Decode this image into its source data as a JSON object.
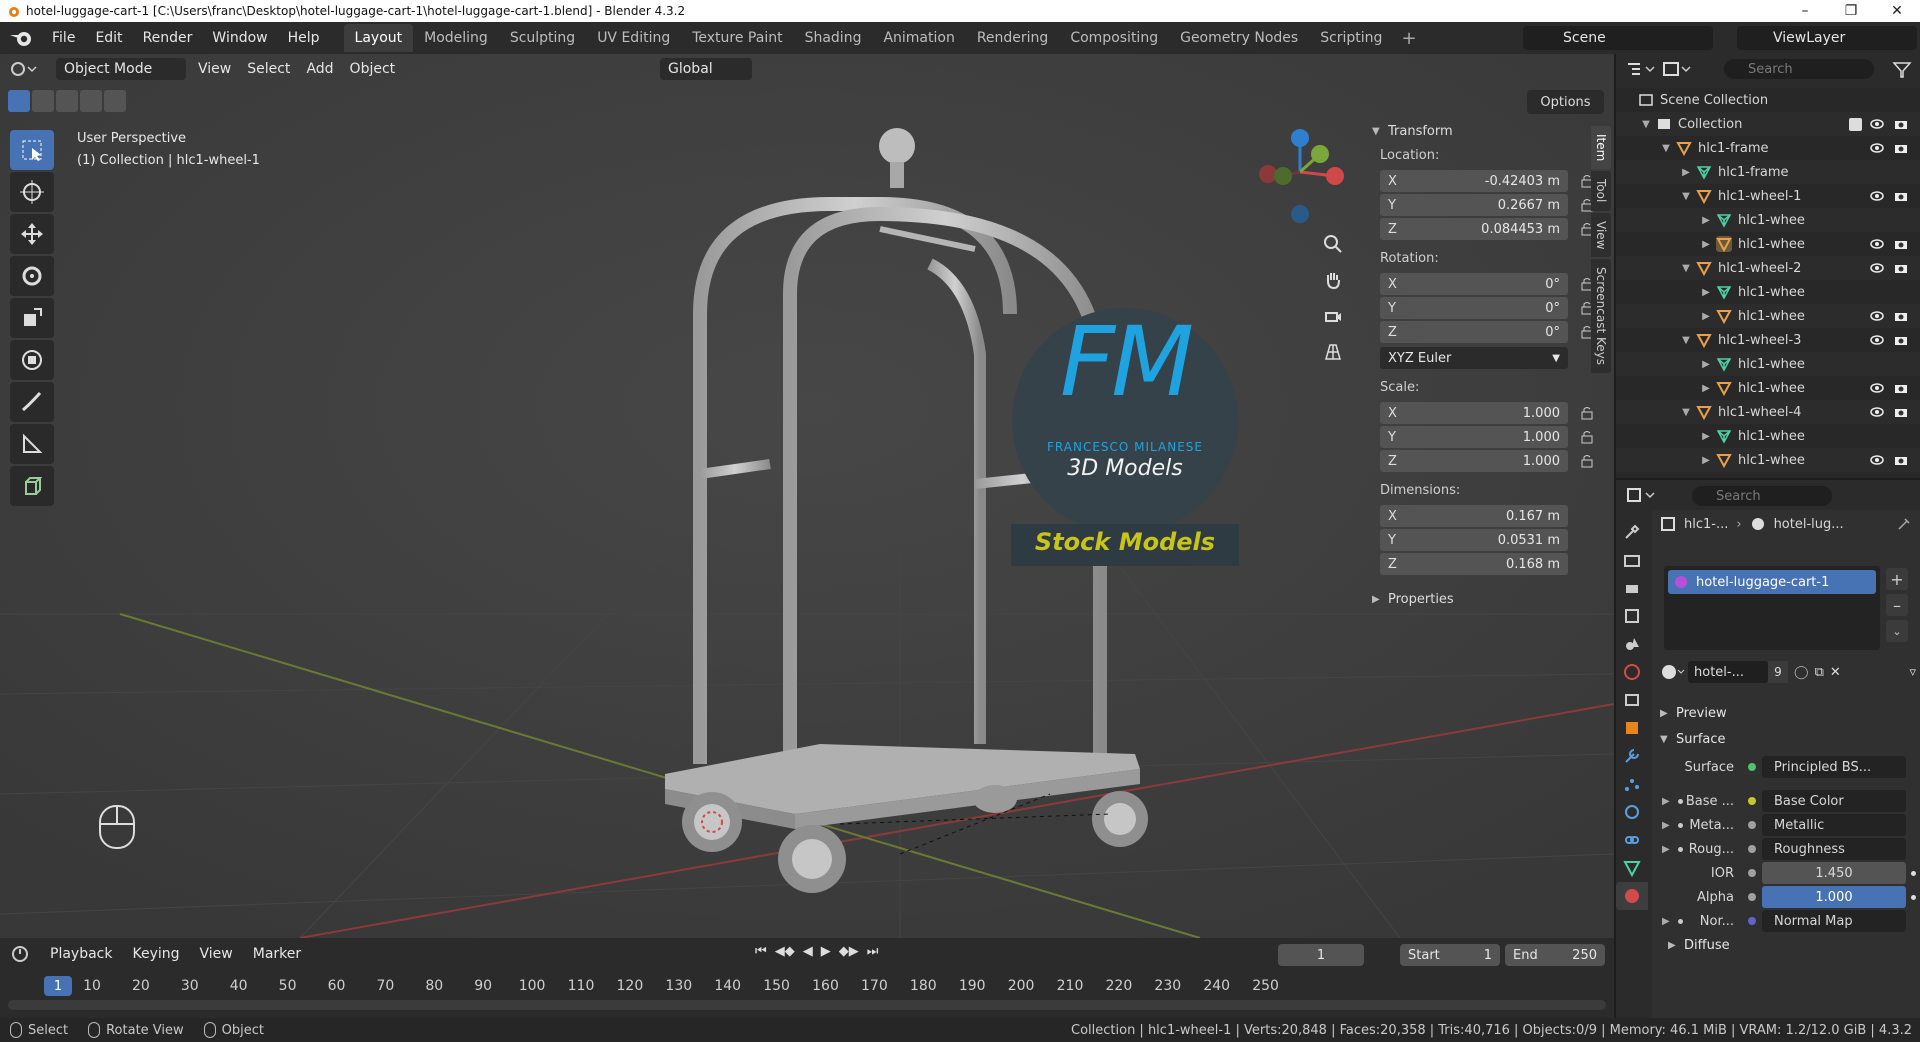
{
  "window": {
    "title": "hotel-luggage-cart-1 [C:\\Users\\franc\\Desktop\\hotel-luggage-cart-1\\hotel-luggage-cart-1.blend] - Blender 4.3.2"
  },
  "menu": [
    "File",
    "Edit",
    "Render",
    "Window",
    "Help"
  ],
  "workspaces": [
    "Layout",
    "Modeling",
    "Sculpting",
    "UV Editing",
    "Texture Paint",
    "Shading",
    "Animation",
    "Rendering",
    "Compositing",
    "Geometry Nodes",
    "Scripting"
  ],
  "active_workspace": "Layout",
  "scene": "Scene",
  "view_layer": "ViewLayer",
  "viewport": {
    "mode": "Object Mode",
    "menus": [
      "View",
      "Select",
      "Add",
      "Object"
    ],
    "orientation": "Global",
    "perspective_label": "User Perspective",
    "context_label": "(1) Collection | hlc1-wheel-1",
    "options_label": "Options",
    "watermark": {
      "brand": "FM",
      "author": "FRANCESCO MILANESE",
      "line": "3D Models",
      "banner": "Stock Models"
    }
  },
  "npanel": {
    "tabs": [
      "Item",
      "Tool",
      "View",
      "Screencast Keys"
    ],
    "transform_title": "Transform",
    "location_label": "Location:",
    "location": [
      {
        "axis": "X",
        "value": "-0.42403 m"
      },
      {
        "axis": "Y",
        "value": "0.2667 m"
      },
      {
        "axis": "Z",
        "value": "0.084453 m"
      }
    ],
    "rotation_label": "Rotation:",
    "rotation": [
      {
        "axis": "X",
        "value": "0°"
      },
      {
        "axis": "Y",
        "value": "0°"
      },
      {
        "axis": "Z",
        "value": "0°"
      }
    ],
    "rotation_mode": "XYZ Euler",
    "scale_label": "Scale:",
    "scale": [
      {
        "axis": "X",
        "value": "1.000"
      },
      {
        "axis": "Y",
        "value": "1.000"
      },
      {
        "axis": "Z",
        "value": "1.000"
      }
    ],
    "dimensions_label": "Dimensions:",
    "dimensions": [
      {
        "axis": "X",
        "value": "0.167 m"
      },
      {
        "axis": "Y",
        "value": "0.0531 m"
      },
      {
        "axis": "Z",
        "value": "0.168 m"
      }
    ],
    "properties_title": "Properties"
  },
  "timeline": {
    "menus": [
      "Playback",
      "Keying",
      "View",
      "Marker"
    ],
    "current_frame": "1",
    "start_label": "Start",
    "start": "1",
    "end_label": "End",
    "end": "250",
    "ticks": [
      "10",
      "20",
      "30",
      "40",
      "50",
      "60",
      "70",
      "80",
      "90",
      "100",
      "110",
      "120",
      "130",
      "140",
      "150",
      "160",
      "170",
      "180",
      "190",
      "200",
      "210",
      "220",
      "230",
      "240",
      "250"
    ]
  },
  "statusbar": {
    "select": "Select",
    "rotate": "Rotate View",
    "object": "Object",
    "stats": "Collection | hlc1-wheel-1 | Verts:20,848 | Faces:20,358 | Tris:40,716 | Objects:0/9 | Memory: 46.1 MiB | VRAM: 1.2/12.0 GiB | 4.3.2"
  },
  "outliner": {
    "search_placeholder": "Search",
    "rows": [
      {
        "label": "Scene Collection",
        "type": "scene"
      },
      {
        "label": "Collection",
        "type": "collection"
      },
      {
        "label": "hlc1-frame",
        "type": "object"
      },
      {
        "label": "hlc1-frame",
        "type": "mesh"
      },
      {
        "label": "hlc1-wheel-1",
        "type": "object"
      },
      {
        "label": "hlc1-whee",
        "type": "mesh"
      },
      {
        "label": "hlc1-whee",
        "type": "object"
      },
      {
        "label": "hlc1-wheel-2",
        "type": "object"
      },
      {
        "label": "hlc1-whee",
        "type": "mesh"
      },
      {
        "label": "hlc1-whee",
        "type": "object"
      },
      {
        "label": "hlc1-wheel-3",
        "type": "object"
      },
      {
        "label": "hlc1-whee",
        "type": "mesh"
      },
      {
        "label": "hlc1-whee",
        "type": "object"
      },
      {
        "label": "hlc1-wheel-4",
        "type": "object"
      },
      {
        "label": "hlc1-whee",
        "type": "mesh"
      },
      {
        "label": "hlc1-whee",
        "type": "object"
      }
    ]
  },
  "properties": {
    "search_placeholder": "Search",
    "crumb_object": "hlc1-...",
    "crumb_material": "hotel-lug...",
    "slot": "hotel-luggage-cart-1",
    "material_name": "hotel-...",
    "users": "9",
    "preview": "Preview",
    "surface": "Surface",
    "surface_label": "Surface",
    "surface_value": "Principled BS...",
    "sockets": [
      {
        "label": "Base ...",
        "value": "Base Color"
      },
      {
        "label": "Meta...",
        "value": "Metallic"
      },
      {
        "label": "Roug...",
        "value": "Roughness"
      }
    ],
    "ior_label": "IOR",
    "ior": "1.450",
    "alpha_label": "Alpha",
    "alpha": "1.000",
    "normal_label": "Nor...",
    "normal_value": "Normal Map",
    "diffuse": "Diffuse"
  }
}
